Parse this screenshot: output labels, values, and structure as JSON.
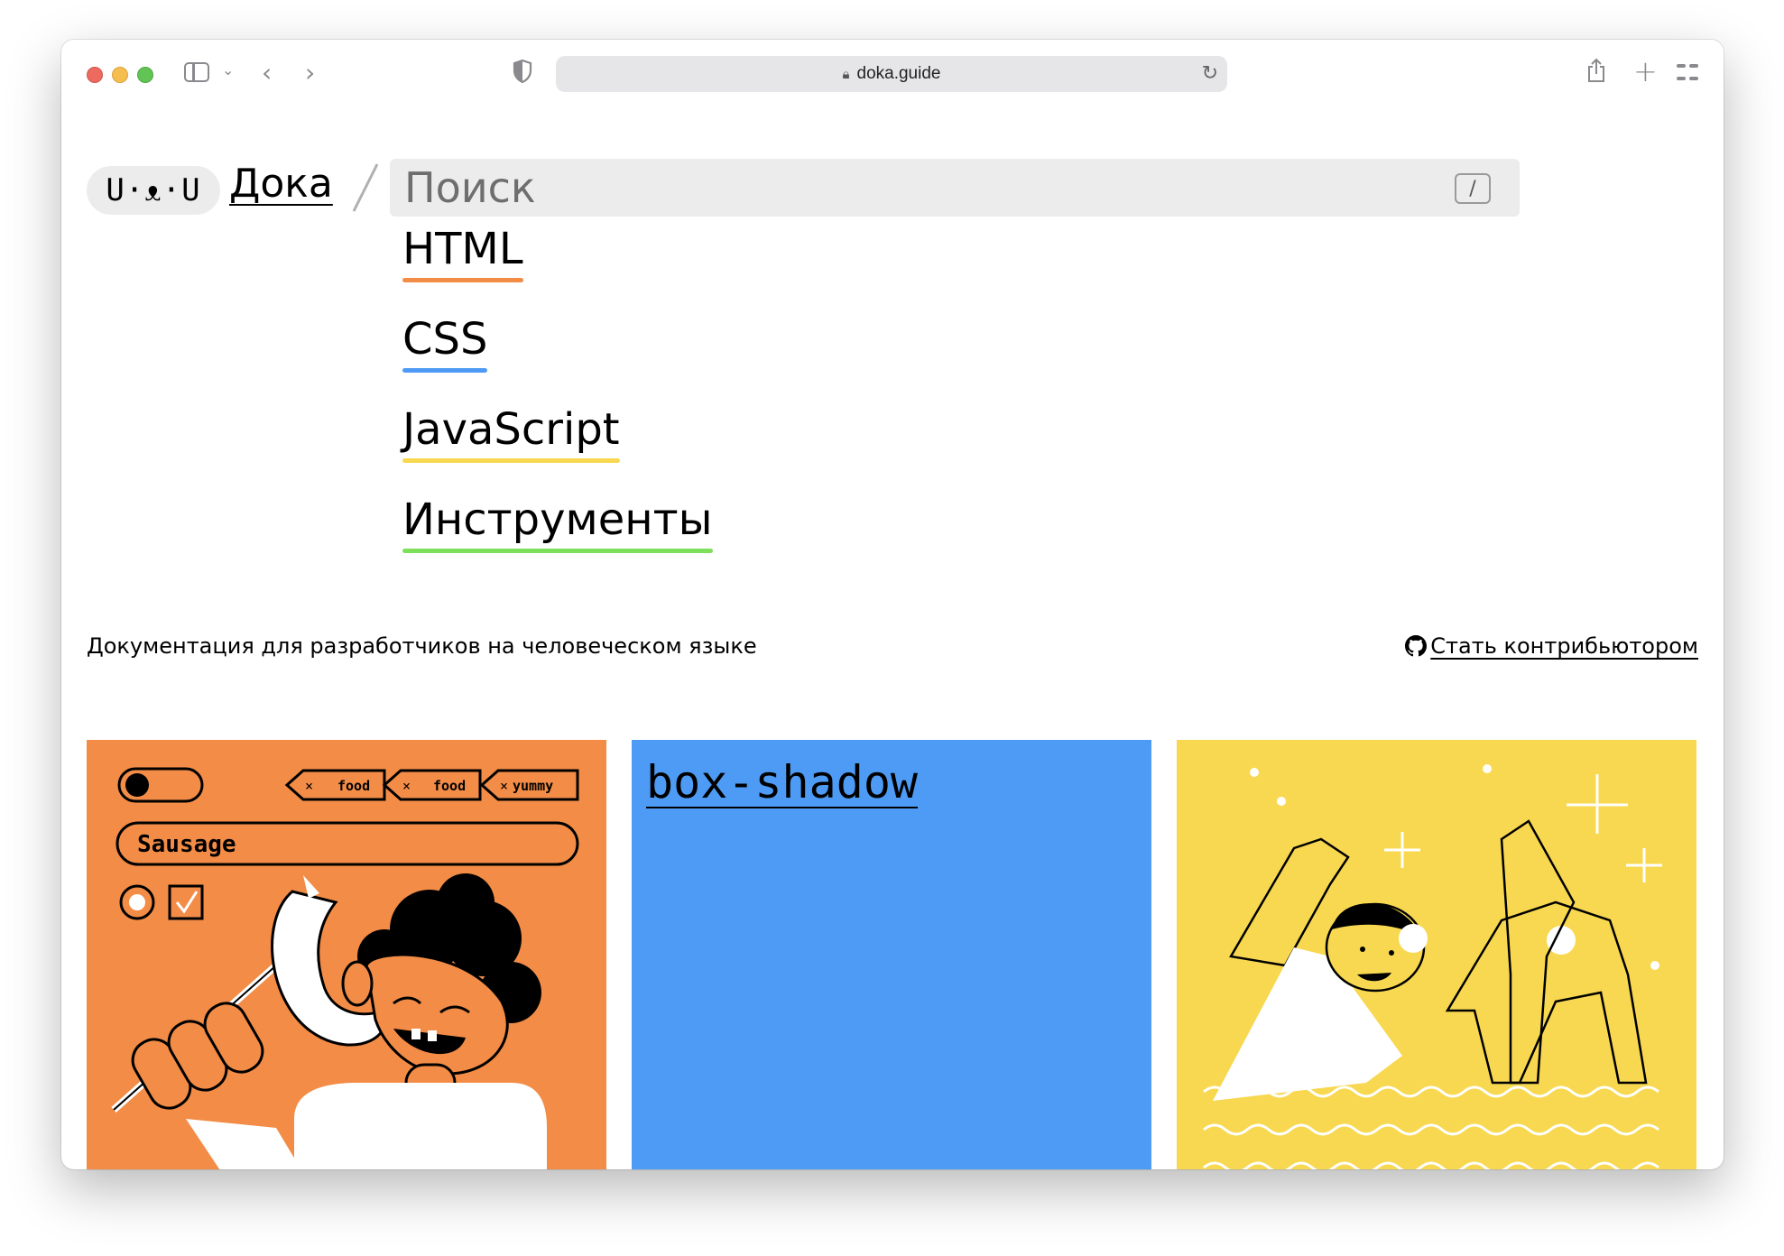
{
  "browser": {
    "url": "doka.guide"
  },
  "header": {
    "logo": "U·ᴥ·U",
    "site_name": "Дока",
    "search_placeholder": "Поиск",
    "search_shortcut": "/"
  },
  "nav": [
    {
      "label": "HTML",
      "color": "#f28c46"
    },
    {
      "label": "CSS",
      "color": "#4d9bf5"
    },
    {
      "label": "JavaScript",
      "color": "#f8d850"
    },
    {
      "label": "Инструменты",
      "color": "#7ee05a"
    }
  ],
  "tagline": "Документация для разработчиков на человеческом языке",
  "contribute": {
    "label": "Стать контрибьютором",
    "icon": "github-icon"
  },
  "cards": [
    {
      "color": "#f28c46",
      "illustration": {
        "tags": [
          "food",
          "food",
          "yummy"
        ],
        "field": "Sausage"
      }
    },
    {
      "color": "#4d9bf5",
      "title": "box-shadow"
    },
    {
      "color": "#f8d850"
    }
  ]
}
